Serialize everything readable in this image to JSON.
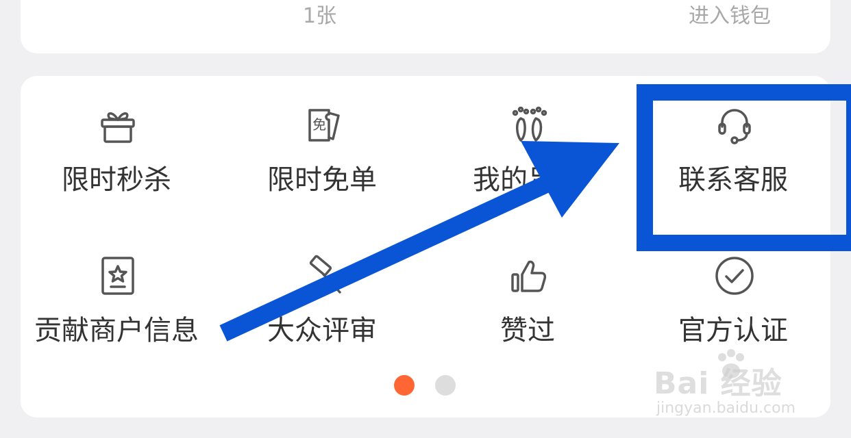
{
  "wallet": {
    "coupon_count": "1张",
    "enter_wallet": "进入钱包"
  },
  "grid": {
    "items": [
      {
        "label": "限时秒杀",
        "icon": "gift-icon"
      },
      {
        "label": "限时免单",
        "icon": "free-ticket-icon"
      },
      {
        "label": "我的足迹",
        "icon": "footprint-icon"
      },
      {
        "label": "联系客服",
        "icon": "headset-icon"
      },
      {
        "label": "贡献商户信息",
        "icon": "merchant-star-icon"
      },
      {
        "label": "大众评审",
        "icon": "gavel-icon"
      },
      {
        "label": "赞过",
        "icon": "thumbs-up-icon"
      },
      {
        "label": "官方认证",
        "icon": "check-circle-icon"
      }
    ],
    "active_page": 1,
    "page_count": 2
  },
  "annotation": {
    "highlight_target": "联系客服",
    "color": "#0a55d6"
  },
  "watermark": {
    "brand": "Bai 经验",
    "url": "jingyan.baidu.com"
  },
  "colors": {
    "dot_active": "#ff6633",
    "dot_inactive": "#dddddd",
    "icon_stroke": "#555555"
  }
}
